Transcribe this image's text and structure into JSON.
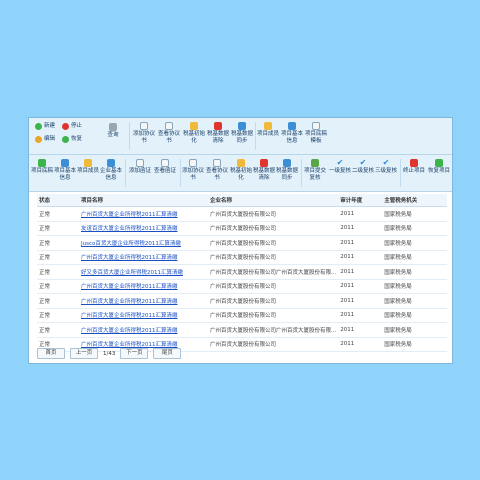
{
  "toolbar1": {
    "new": "新建",
    "stop": "停止",
    "edit": "编辑",
    "restore": "恢复",
    "query": "查询",
    "add_protocol": "添加协议书",
    "view_protocol": "查看协议书",
    "tax_data_init": "税基初始化",
    "tax_data_clear": "税基数据清除",
    "tax_data_sync": "税基数据同步",
    "project_members": "项目成员",
    "project_basic_info": "项目基本信息",
    "project_tax_template": "项目底稿模板"
  },
  "toolbar2": {
    "project_tax": "项目底稿",
    "project_basic_info": "项目基本信息",
    "project_members": "项目成员",
    "enterprise_basic_info": "企业基本信息",
    "add_survey": "添加函证",
    "view_survey": "查看函证",
    "add_protocol": "添加协议书",
    "view_protocol": "查看协议书",
    "tax_data_init": "税基初始化",
    "tax_data_clear": "税基数据清除",
    "tax_data_sync": "税基数据同步",
    "project_submit_review": "项目提交复核",
    "review_1": "一级复核",
    "review_2": "二级复核",
    "review_3": "三级复核",
    "terminate_project": "终止项目",
    "restore_project": "恢复项目"
  },
  "grid": {
    "columns": [
      "状态",
      "项目名称",
      "企业名称",
      "审计年度",
      "主管税务机关"
    ],
    "rows": [
      [
        "正常",
        "广州百货大厦企业所得税2011汇算清缴",
        "广州百货大厦股份有限公司",
        "2011",
        "国家税务局"
      ],
      [
        "正常",
        "友谊百货大厦企业所得税2011汇算清缴",
        "广州百货大厦股份有限公司",
        "2011",
        "国家税务局"
      ],
      [
        "正常",
        "Jusco百货大厦企业所得税2011汇算清缴",
        "广州百货大厦股份有限公司",
        "2011",
        "国家税务局"
      ],
      [
        "正常",
        "广州百货大厦企业所得税2011汇算清缴",
        "广州百货大厦股份有限公司",
        "2011",
        "国家税务局"
      ],
      [
        "正常",
        "好又多百货大厦企业所得税2011汇算清缴",
        "广州百货大厦股份有限公司广州百货大厦股份有限...",
        "2011",
        "国家税务局"
      ],
      [
        "正常",
        "广州百货大厦企业所得税2011汇算清缴",
        "广州百货大厦股份有限公司",
        "2011",
        "国家税务局"
      ],
      [
        "正常",
        "广州百货大厦企业所得税2011汇算清缴",
        "广州百货大厦股份有限公司",
        "2011",
        "国家税务局"
      ],
      [
        "正常",
        "广州百货大厦企业所得税2011汇算清缴",
        "广州百货大厦股份有限公司",
        "2011",
        "国家税务局"
      ],
      [
        "正常",
        "广州百货大厦企业所得税2011汇算清缴",
        "广州百货大厦股份有限公司广州百货大厦股份有限...",
        "2011",
        "国家税务局"
      ],
      [
        "正常",
        "广州百货大厦企业所得税2011汇算清缴",
        "广州百货大厦股份有限公司",
        "2011",
        "国家税务局"
      ]
    ]
  },
  "pager": {
    "first": "首页",
    "prev": "上一页",
    "page_info": "1/43",
    "next": "下一页",
    "last": "尾页"
  }
}
